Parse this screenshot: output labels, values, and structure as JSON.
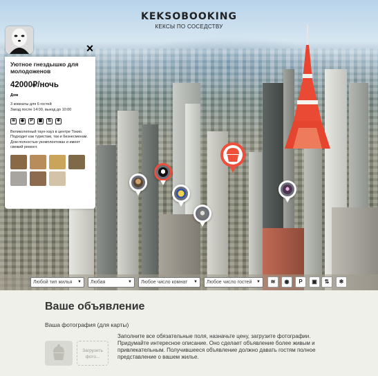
{
  "header": {
    "logo": "KEKSOBOOKING",
    "tagline": "КЕКСЫ ПО СОСЕДСТВУ"
  },
  "offer": {
    "close_icon": "×",
    "title": "Уютное гнездышко для молодоженов",
    "price": "42000₽/ночь",
    "type": "Дом",
    "capacity": "3 комнаты для 6 гостей",
    "time": "Заезд после 14:00, выезд до 10:00",
    "features": [
      "wifi-icon",
      "dishwasher-icon",
      "parking-icon",
      "washer-icon",
      "elevator-icon",
      "conditioner-icon"
    ],
    "feature_glyphs": [
      "≋",
      "◉",
      "P",
      "▣",
      "⇅",
      "❄"
    ],
    "description": "Великолепный таун-хауз в центре Токио. Подходит как туристам, так и бизнесменам. Дом полностью укомплектован и имеет свежий ремонт.",
    "photo_colors": [
      "#8a6a46",
      "#b98d5b",
      "#c9a45a",
      "#7e6a49",
      "#a8a4a0",
      "#8d6b4e",
      "#d3c3a9"
    ]
  },
  "filters": {
    "type": "Любой тип жилья",
    "price": "Любая",
    "rooms": "Любое число комнат",
    "guests": "Любое число гостей",
    "features": [
      "wifi-icon",
      "dishwasher-icon",
      "parking-icon",
      "washer-icon",
      "elevator-icon",
      "conditioner-icon"
    ],
    "feature_glyphs": [
      "≋",
      "◉",
      "P",
      "▣",
      "⇅",
      "❄"
    ]
  },
  "form": {
    "title": "Ваше объявление",
    "photo_label": "Ваша фотография (для карты)",
    "upload_label": "Загрузить фото...",
    "hint": "Заполните все обязательные поля, назначьте цену, загрузите фотографии. Придумайте интересное описание. Оно сделает объявление более живым и привлекательным. Получившееся объявление должно давать гостям полное представление о вашем жилье."
  },
  "colors": {
    "main_pin": "#ef4e3a",
    "accent_bg": "#f0f0ea"
  }
}
